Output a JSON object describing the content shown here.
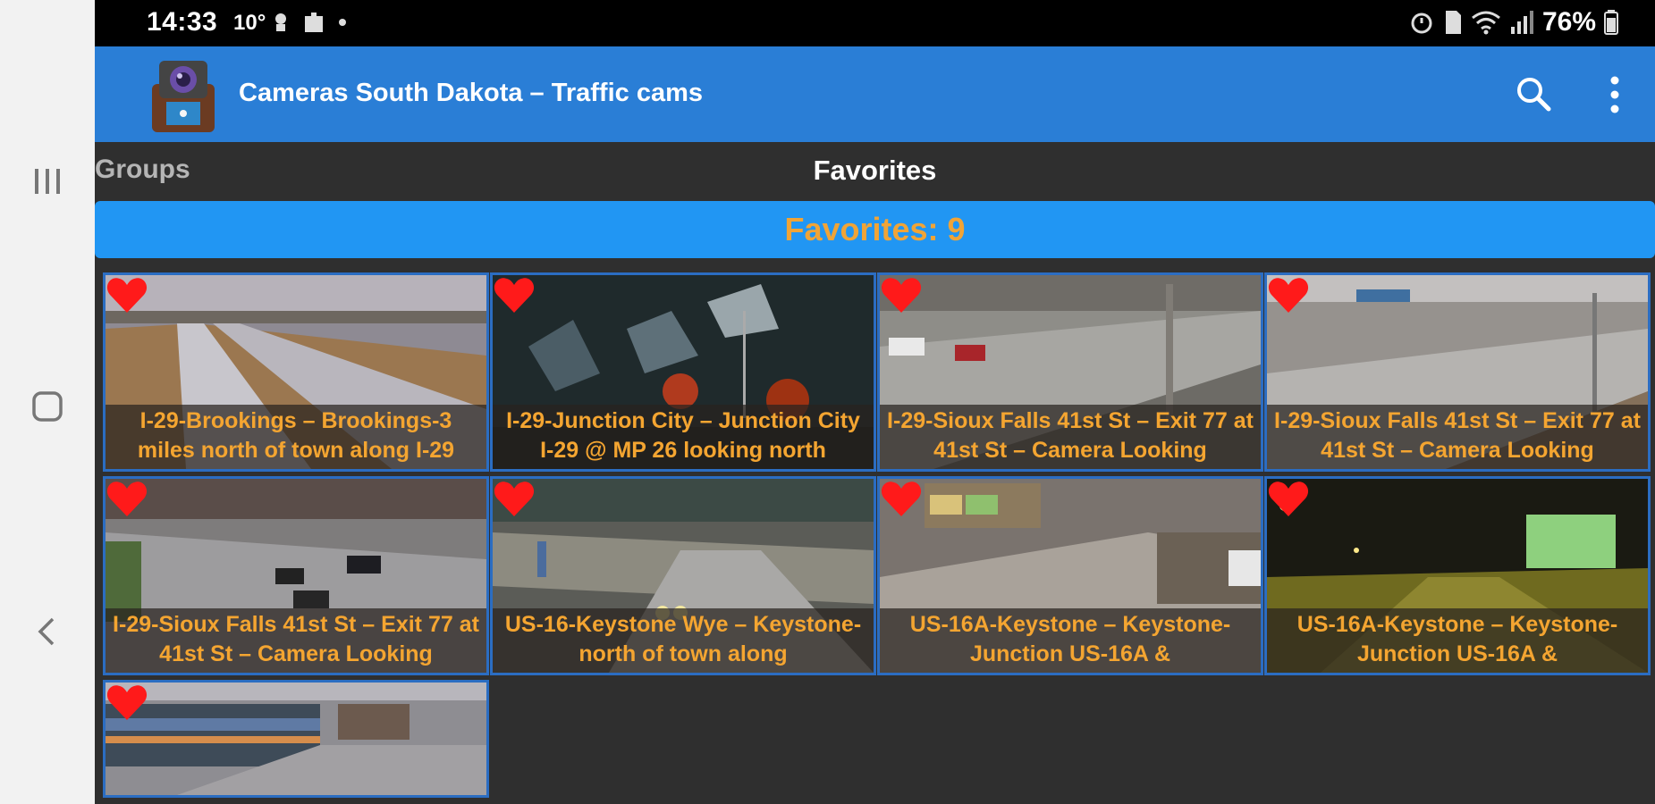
{
  "status_bar": {
    "time": "14:33",
    "temperature": "10°",
    "battery": "76%",
    "icons": [
      "alarm-icon",
      "sim-icon",
      "wifi-icon",
      "signal-icon",
      "battery-icon"
    ]
  },
  "app_bar": {
    "title": "Cameras South Dakota – Traffic cams",
    "actions": [
      "search-icon",
      "overflow-menu-icon"
    ]
  },
  "tabs": {
    "groups_label": "Groups",
    "favorites_label": "Favorites"
  },
  "banner": {
    "label": "Favorites: 9"
  },
  "colors": {
    "app_bar": "#2a7ed6",
    "banner": "#2196f3",
    "caption_text": "#f4a531",
    "heart": "#ff1a1a"
  },
  "cameras": [
    {
      "title": "I-29-Brookings – Brookings-3 miles north of town along I-29",
      "favorite": true
    },
    {
      "title": "I-29-Junction City – Junction City I-29 @ MP 26 looking north",
      "favorite": true
    },
    {
      "title": "I-29-Sioux Falls 41st St – Exit 77 at 41st St – Camera Looking",
      "favorite": true
    },
    {
      "title": "I-29-Sioux Falls 41st St – Exit 77 at 41st St – Camera Looking",
      "favorite": true
    },
    {
      "title": "I-29-Sioux Falls 41st St – Exit 77 at 41st St – Camera Looking",
      "favorite": true
    },
    {
      "title": "US-16-Keystone Wye – Keystone-north of town along",
      "favorite": true
    },
    {
      "title": "US-16A-Keystone – Keystone-Junction US-16A &",
      "favorite": true
    },
    {
      "title": "US-16A-Keystone – Keystone-Junction US-16A &",
      "favorite": true
    },
    {
      "title": "",
      "favorite": true
    }
  ]
}
